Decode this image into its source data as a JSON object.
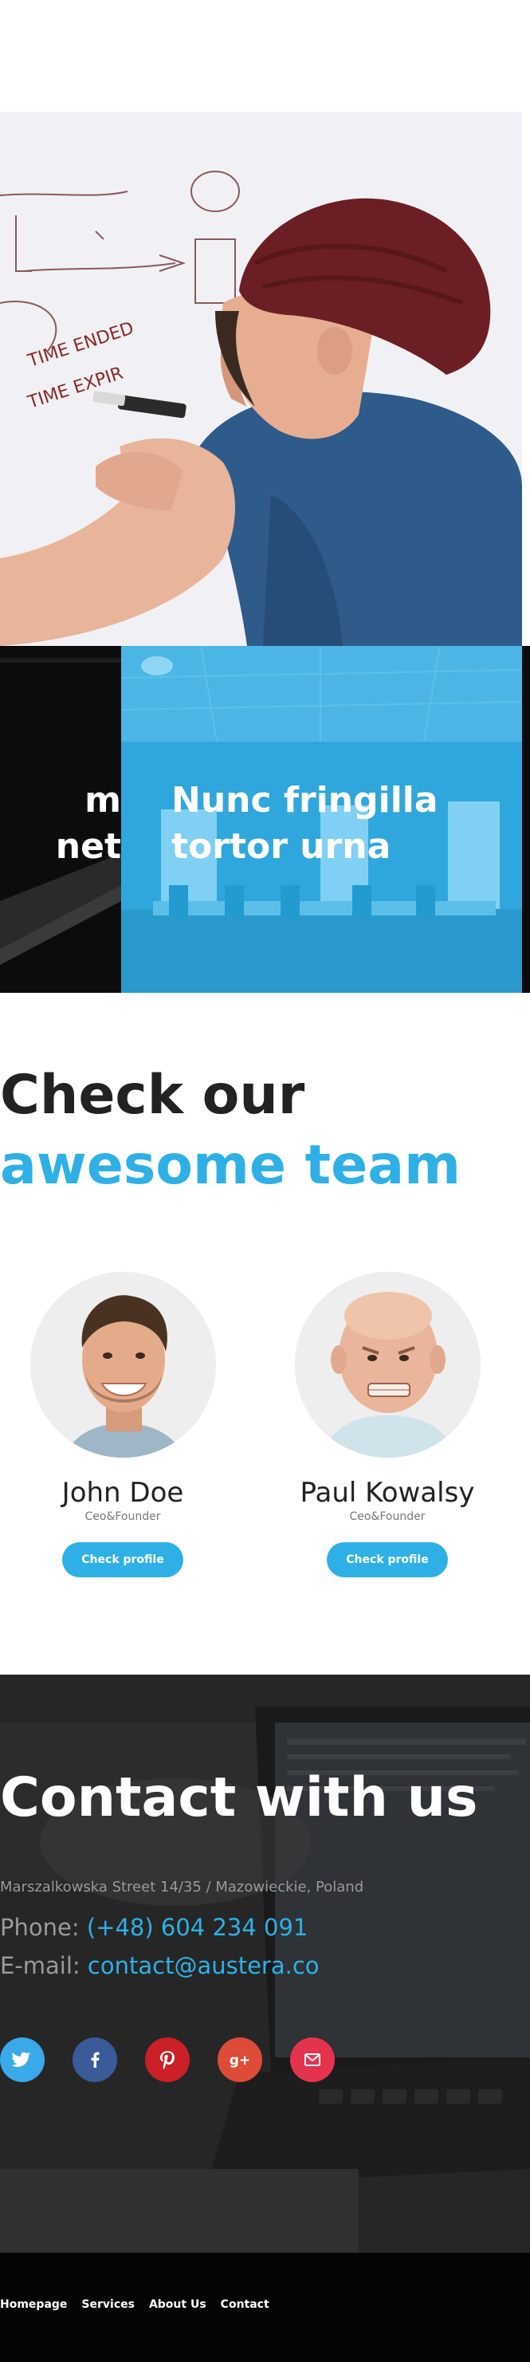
{
  "tiles": {
    "dark_line1": "m",
    "dark_line2": "net",
    "blue_line1": "Nunc fringilla",
    "blue_line2": "tortor urna"
  },
  "team": {
    "title_line1": "Check our",
    "title_line2": "awesome team",
    "members": [
      {
        "name": "John Doe",
        "role": "Ceo&Founder",
        "button": "Check profile"
      },
      {
        "name": "Paul Kowalsy",
        "role": "Ceo&Founder",
        "button": "Check profile"
      }
    ]
  },
  "contact": {
    "title": "Contact with us",
    "address": "Marszalkowska Street 14/35 / Mazowieckie, Poland",
    "phone_label": "Phone:",
    "phone_value": "(+48) 604 234 091",
    "email_label": "E-mail:",
    "email_value": "contact@austera.co",
    "social": [
      {
        "icon": "twitter-icon",
        "color": "#39a9e8"
      },
      {
        "icon": "facebook-icon",
        "color": "#3a5a98"
      },
      {
        "icon": "pinterest-icon",
        "color": "#cb2027"
      },
      {
        "icon": "google-plus-icon",
        "color": "#dd4b39"
      },
      {
        "icon": "email-icon",
        "color": "#e4344d"
      }
    ]
  },
  "footer": {
    "nav": [
      "Homepage",
      "Services",
      "About Us",
      "Contact"
    ]
  },
  "colors": {
    "accent": "#2eb0e6",
    "dark": "#222222"
  }
}
